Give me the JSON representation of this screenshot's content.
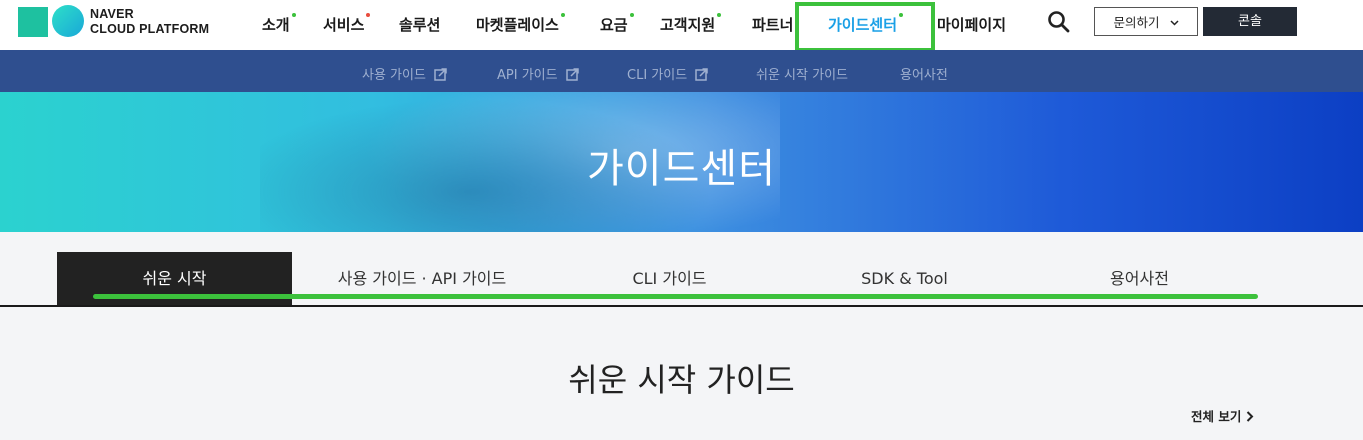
{
  "brand": {
    "logo_line1": "NAVER",
    "logo_line2": "CLOUD PLATFORM",
    "colors": {
      "logo_square": "#1ec1a0",
      "logo_circle": "#19a7d8"
    }
  },
  "gnb": {
    "items": [
      {
        "label": "소개",
        "dot": "#3cc13c"
      },
      {
        "label": "서비스",
        "dot": "#e84c3d"
      },
      {
        "label": "솔루션",
        "dot": ""
      },
      {
        "label": "마켓플레이스",
        "dot": "#3cc13c"
      },
      {
        "label": "요금",
        "dot": "#3cc13c"
      },
      {
        "label": "고객지원",
        "dot": "#3cc13c"
      },
      {
        "label": "파트너",
        "dot": "#3cc13c"
      },
      {
        "label": "가이드센터",
        "dot": "#3cc13c",
        "active": true
      },
      {
        "label": "마이페이지",
        "dot": ""
      }
    ],
    "search_icon": "search-icon",
    "inquiry_label": "문의하기",
    "console_label": "콘솔",
    "active_color": "#1aa0e6",
    "highlight_color": "#3cc13c"
  },
  "subnav": {
    "items": [
      {
        "label": "사용 가이드",
        "external": true
      },
      {
        "label": "API 가이드",
        "external": true
      },
      {
        "label": "CLI 가이드",
        "external": true
      },
      {
        "label": "쉬운 시작 가이드",
        "external": false
      },
      {
        "label": "용어사전",
        "external": false
      }
    ],
    "background": "#2f4f8f"
  },
  "hero": {
    "title": "가이드센터"
  },
  "tabs": {
    "items": [
      {
        "label": "쉬운 시작",
        "active": true
      },
      {
        "label": "사용 가이드 · API 가이드",
        "active": false
      },
      {
        "label": "CLI 가이드",
        "active": false
      },
      {
        "label": "SDK & Tool",
        "active": false
      },
      {
        "label": "용어사전",
        "active": false
      }
    ]
  },
  "content": {
    "title": "쉬운 시작 가이드",
    "view_all_label": "전체 보기"
  }
}
